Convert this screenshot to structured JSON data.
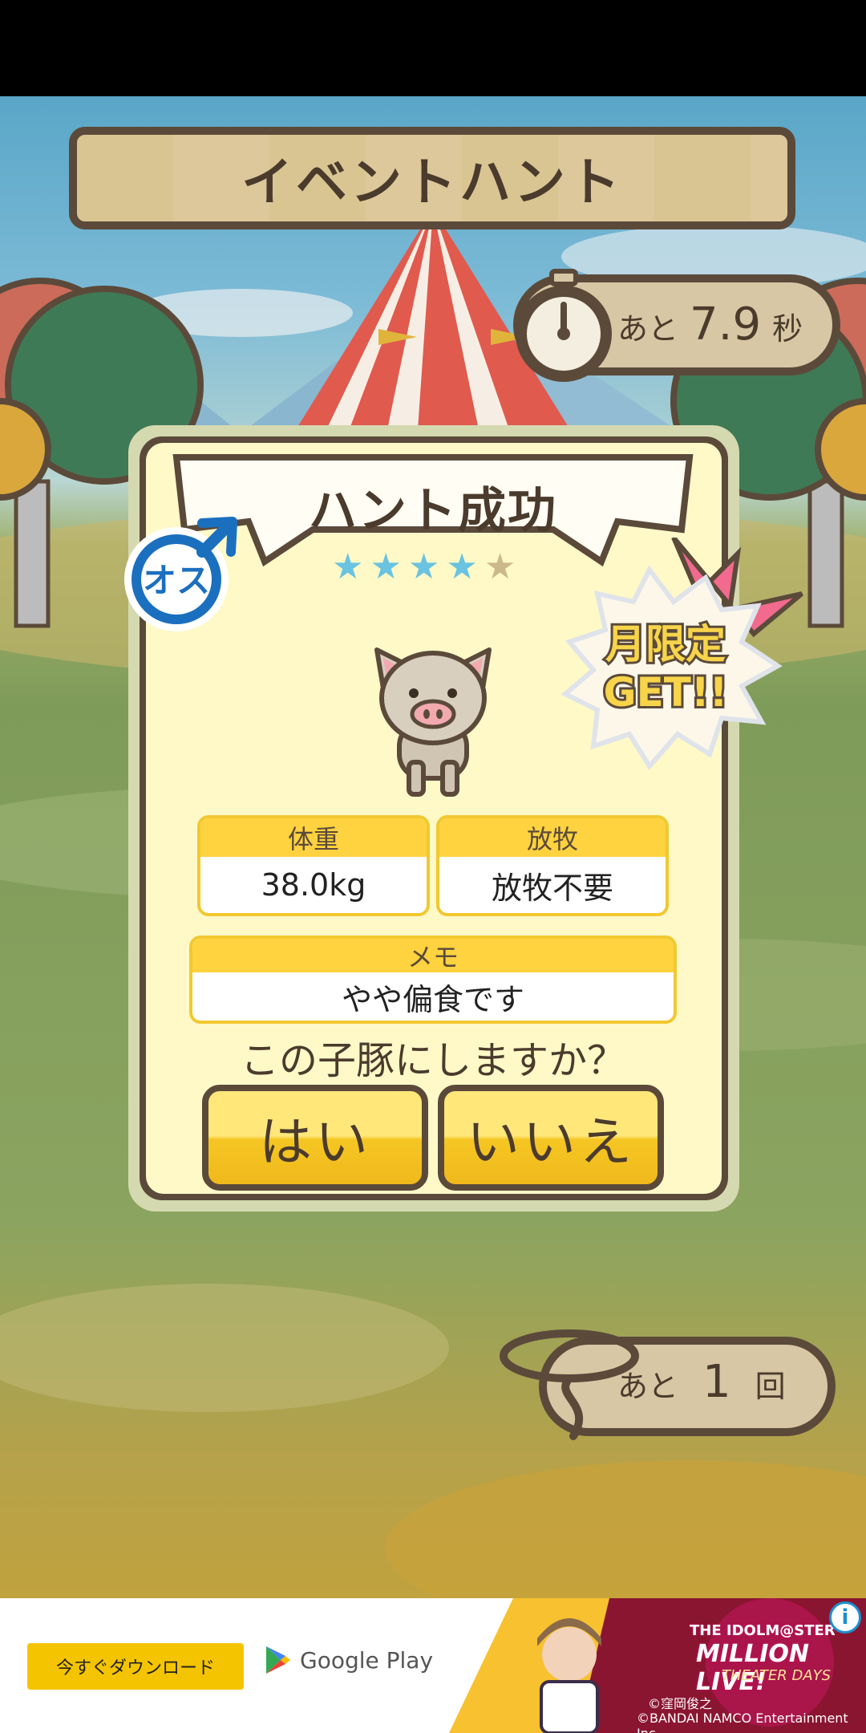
{
  "header": {
    "title": "イベントハント"
  },
  "timer": {
    "prefix": "あと",
    "value": "7.9",
    "unit": "秒"
  },
  "remaining": {
    "prefix": "あと",
    "value": "1",
    "unit": "回"
  },
  "result": {
    "title": "ハント成功",
    "stars_filled": 4,
    "stars_total": 5,
    "gender": "オス",
    "badge_line1": "月限定",
    "badge_line2": "GET!!",
    "stats": {
      "weight_label": "体重",
      "weight_value": "38.0kg",
      "graze_label": "放牧",
      "graze_value": "放牧不要",
      "memo_label": "メモ",
      "memo_value": "やや偏食です"
    },
    "question": "この子豚にしますか？",
    "yes_label": "はい",
    "no_label": "いいえ"
  },
  "ad": {
    "download_label": "今すぐダウンロード",
    "store_label": "Google Play",
    "brand_line1": "THE IDOLM@STER",
    "brand_line2": "MILLION LIVE!",
    "brand_line3": "THEATER DAYS",
    "copyright1": "©窪岡俊之",
    "copyright2": "©BANDAI NAMCO Entertainment Inc.",
    "info_glyph": "i"
  },
  "colors": {
    "wood_dark": "#5b4a3a",
    "card_cream": "#fff9c8",
    "button_yellow": "#f5c623",
    "star_blue": "#6ac3e0"
  }
}
